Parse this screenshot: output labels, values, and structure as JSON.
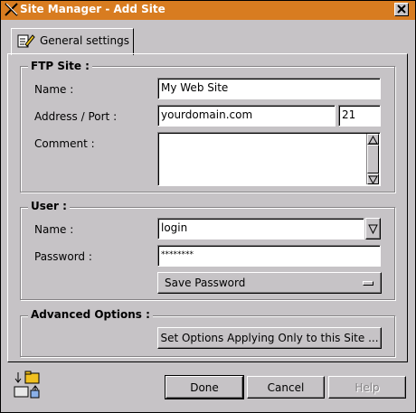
{
  "window": {
    "title": "Site Manager - Add Site"
  },
  "tab": {
    "label": "General settings"
  },
  "ftp_site": {
    "legend": "FTP Site :",
    "name_label": "Name :",
    "name_value": "My Web Site",
    "address_label": "Address / Port :",
    "address_value": "yourdomain.com",
    "port_value": "21",
    "comment_label": "Comment :",
    "comment_value": ""
  },
  "user": {
    "legend": "User :",
    "name_label": "Name :",
    "name_value": "login",
    "password_label": "Password :",
    "password_value": "********",
    "save_password_label": "Save Password"
  },
  "advanced": {
    "legend": "Advanced Options :",
    "set_options_label": "Set Options Applying Only to this Site ..."
  },
  "footer": {
    "done_label": "Done",
    "cancel_label": "Cancel",
    "help_label": "Help"
  },
  "colors": {
    "titlebar": "#d87c20",
    "face": "#c6c3c6"
  },
  "icons": [
    "x-logo-icon",
    "close-icon",
    "edit-settings-icon",
    "scroll-up-icon",
    "scroll-down-icon",
    "dropdown-arrow-icon",
    "toggle-indicator-icon",
    "transfer-folder-icon"
  ]
}
